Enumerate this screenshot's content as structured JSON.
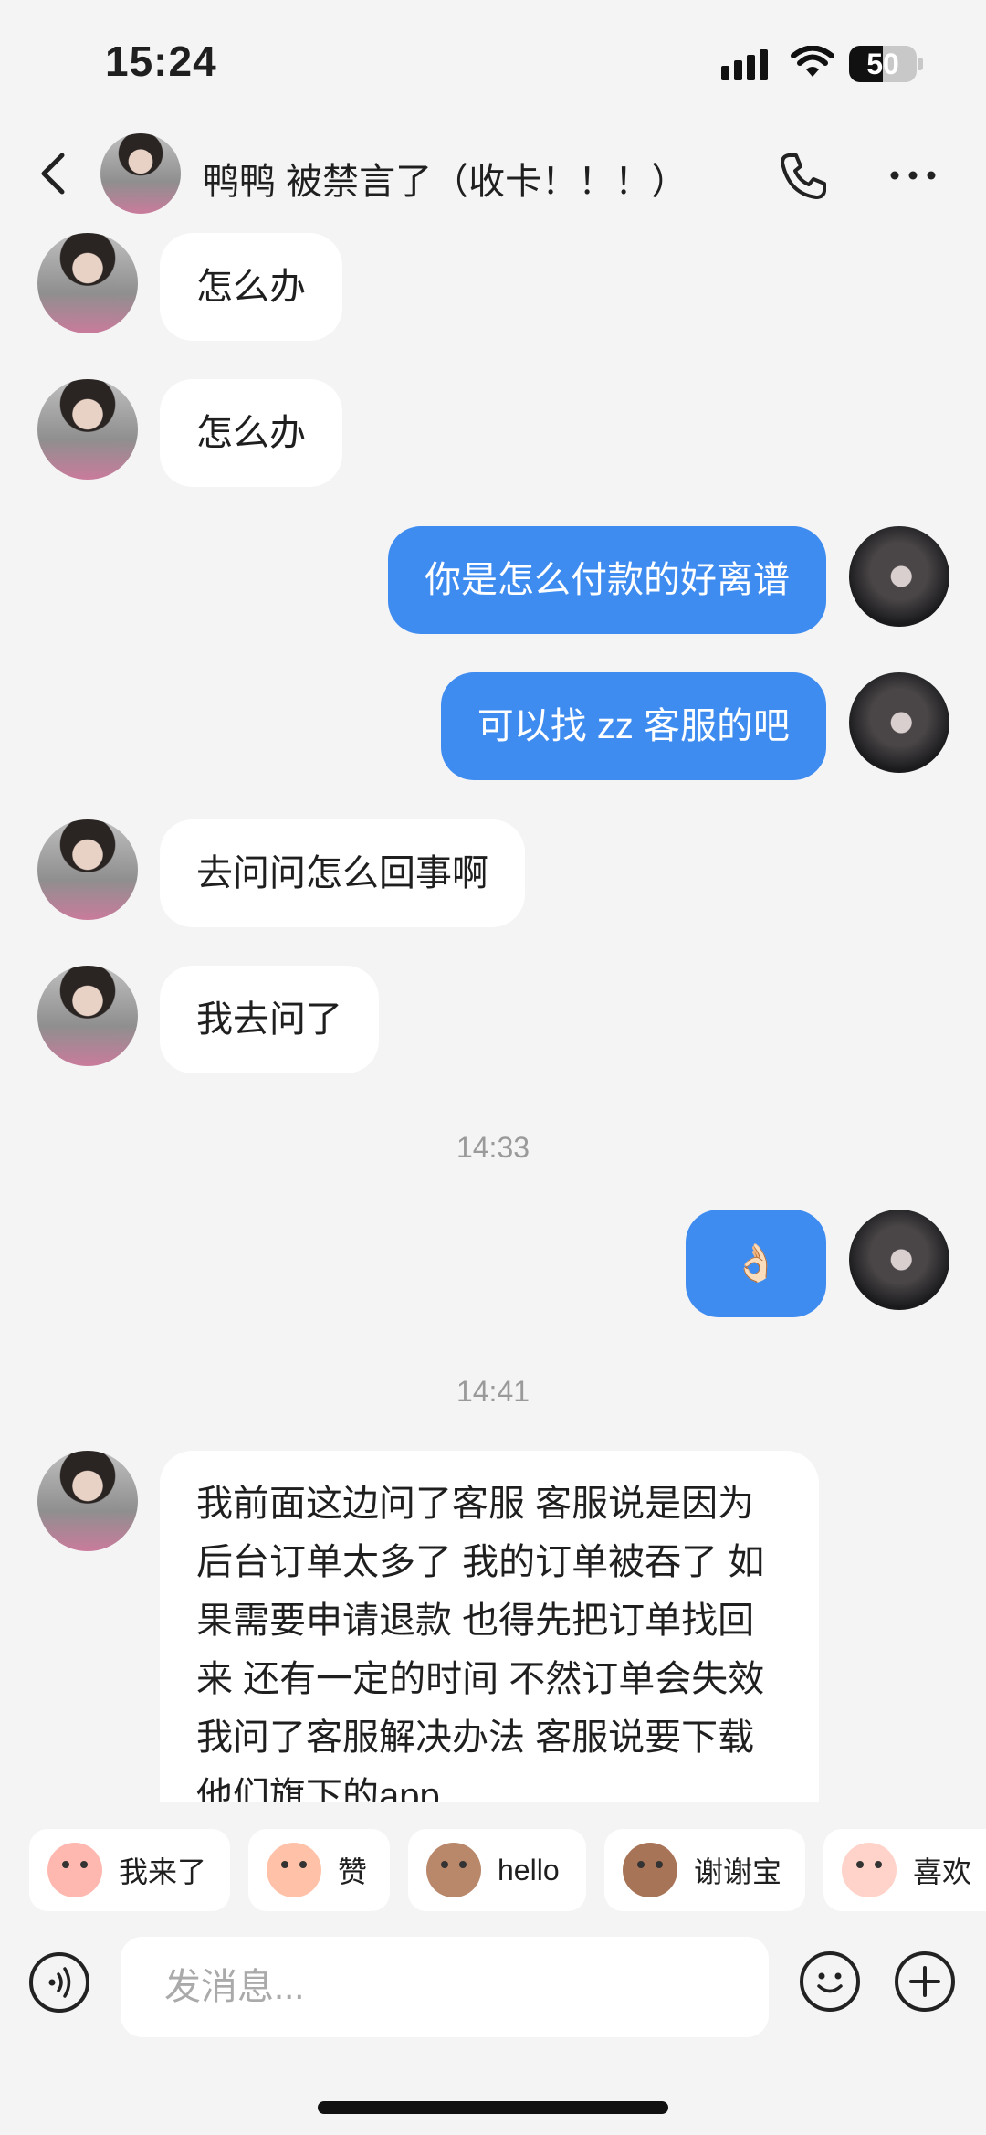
{
  "status_bar": {
    "time": "15:24",
    "battery": "50"
  },
  "header": {
    "title": "鸭鸭 被禁言了（收卡！！！）"
  },
  "messages": [
    {
      "side": "in",
      "text": "怎么办"
    },
    {
      "side": "in",
      "text": "怎么办"
    },
    {
      "side": "out",
      "text": "你是怎么付款的好离谱"
    },
    {
      "side": "out",
      "text": "可以找 zz 客服的吧"
    },
    {
      "side": "in",
      "text": "去问问怎么回事啊"
    },
    {
      "side": "in",
      "text": "我去问了"
    },
    {
      "side": "time",
      "text": "14:33"
    },
    {
      "side": "out",
      "text": "👌🏻"
    },
    {
      "side": "time",
      "text": "14:41"
    },
    {
      "side": "in",
      "text": "我前面这边问了客服 客服说是因为后台订单太多了 我的订单被吞了 如果需要申请退款 也得先把订单找回来 还有一定的时间 不然订单会失效 我问了客服解决办法 客服说要下载他们旗下的app"
    }
  ],
  "quick_replies": [
    {
      "label": "我来了",
      "icon": "sticker-icon",
      "color": "#ffb8b0"
    },
    {
      "label": "赞",
      "icon": "sticker-icon",
      "color": "#ffc2a8"
    },
    {
      "label": "hello",
      "icon": "monkey-sticker-icon",
      "color": "#b9876a"
    },
    {
      "label": "谢谢宝",
      "icon": "monkey-sticker-icon",
      "color": "#a87457"
    },
    {
      "label": "喜欢",
      "icon": "sticker-icon",
      "color": "#ffd3c9"
    }
  ],
  "composer": {
    "placeholder": "发消息..."
  },
  "colors": {
    "accent": "#3f8cf1",
    "background": "#f4f4f5"
  }
}
